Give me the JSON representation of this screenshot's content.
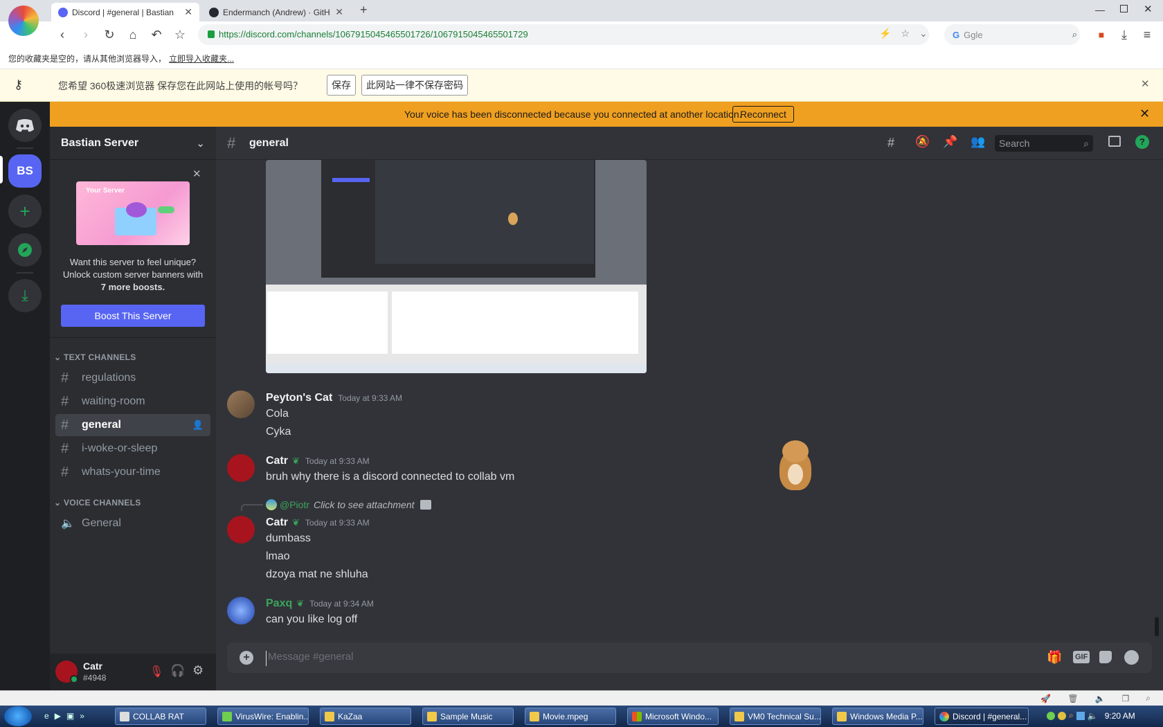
{
  "browser": {
    "tabs": [
      {
        "title": "Discord | #general | Bastian",
        "favicon_color": "#5865f2"
      },
      {
        "title": "Endermanch (Andrew) · GitH...",
        "favicon_color": "#24292f"
      }
    ],
    "url": "https://discord.com/channels/1067915045465501726/1067915045465501729",
    "search_engine": "Ggle",
    "bookmarks_text": "您的收藏夹是空的，请从其他浏览器导入，",
    "bookmarks_link": "立即导入收藏夹..."
  },
  "password_bar": {
    "prompt": "您希望 360极速浏览器 保存您在此网站上使用的帐号吗？",
    "save": "保存",
    "never": "此网站一律不保存密码"
  },
  "notice": {
    "text": "Your voice has been disconnected because you connected at another location.",
    "button": "Reconnect"
  },
  "guilds": {
    "server_abbr": "BS",
    "accent": "#5865f2",
    "green": "#23a559"
  },
  "server": {
    "name": "Bastian Server",
    "boost_card": {
      "banner_label": "Your Server",
      "line1": "Want this server to feel unique?",
      "line2": "Unlock custom server banners with",
      "line3": "7 more boosts.",
      "button": "Boost This Server"
    },
    "text_category": "TEXT CHANNELS",
    "text_channels": [
      "regulations",
      "waiting-room",
      "general",
      "i-woke-or-sleep",
      "whats-your-time"
    ],
    "voice_category": "VOICE CHANNELS",
    "voice_channels": [
      "General"
    ]
  },
  "user": {
    "name": "Catr",
    "tag": "#4948"
  },
  "chat": {
    "channel": "general",
    "search_placeholder": "Search",
    "messages": [
      {
        "author": "Peyton's Cat",
        "time": "Today at 9:33 AM",
        "lines": [
          "Cola",
          "Cyka"
        ]
      },
      {
        "author": "Catr",
        "time": "Today at 9:33 AM",
        "lines": [
          "bruh why there is a discord connected to collab vm"
        ]
      },
      {
        "reply_to": "@Piotr",
        "reply_text": "Click to see attachment",
        "author": "Catr",
        "time": "Today at 9:33 AM",
        "lines": [
          "dumbass",
          "lmao",
          "dzoya mat ne shluha"
        ]
      },
      {
        "author": "Paxq",
        "time": "Today at 9:34 AM",
        "lines": [
          "can you like log off"
        ],
        "author_color": "#3ba55c"
      }
    ],
    "input_placeholder": "Message #general"
  },
  "taskbar": {
    "items": [
      "COLLAB RAT",
      "VirusWire: Enablin...",
      "KaZaa",
      "Sample Music",
      "Movie.mpeg",
      "Microsoft Windo...",
      "VM0 Technical Su...",
      "Windows Media P...",
      "Discord | #general..."
    ],
    "clock": "9:20 AM"
  }
}
